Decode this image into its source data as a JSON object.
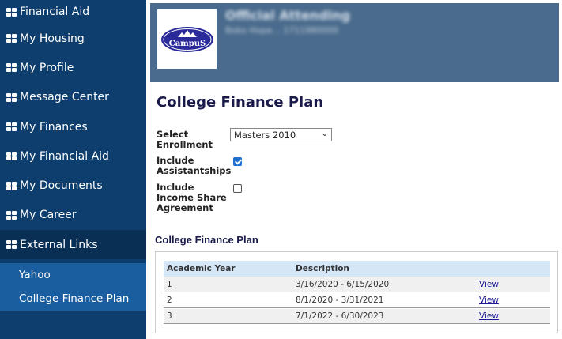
{
  "sidebar": {
    "items": [
      {
        "label": "Financial Aid"
      },
      {
        "label": "My Housing"
      },
      {
        "label": "My Profile"
      },
      {
        "label": "Message Center"
      },
      {
        "label": "My Finances"
      },
      {
        "label": "My Financial Aid"
      },
      {
        "label": "My Documents"
      },
      {
        "label": "My Career"
      },
      {
        "label": "External Links"
      }
    ],
    "sub_items": [
      {
        "label": "Yahoo"
      },
      {
        "label": "College Finance Plan"
      }
    ]
  },
  "header": {
    "logo_text": "CampuS",
    "title": "Official Attending",
    "subtitle": "Bobs Hope... 1711980000"
  },
  "page": {
    "title": "College Finance Plan"
  },
  "form": {
    "enrollment_label_1": "Select",
    "enrollment_label_2": "Enrollment",
    "enrollment_value": "Masters 2010",
    "assist_label_1": "Include",
    "assist_label_2": "Assistantships",
    "assist_checked": true,
    "isa_label_1": "Include",
    "isa_label_2": "Income Share",
    "isa_label_3": "Agreement",
    "isa_checked": false
  },
  "plan": {
    "title": "College Finance Plan",
    "columns": [
      "Academic Year",
      "Description",
      ""
    ],
    "rows": [
      {
        "year": "1",
        "description": "3/16/2020 - 6/15/2020",
        "action": "View"
      },
      {
        "year": "2",
        "description": "8/1/2020 - 3/31/2021",
        "action": "View"
      },
      {
        "year": "3",
        "description": "7/1/2022 - 6/30/2023",
        "action": "View"
      }
    ]
  },
  "colors": {
    "sidebar_bg": "#0d3e6e",
    "sidebar_sub_bg": "#1a5ea0",
    "header_bg": "#4a6b8d",
    "table_header_bg": "#d5e6f6",
    "link": "#1a1a9a"
  }
}
